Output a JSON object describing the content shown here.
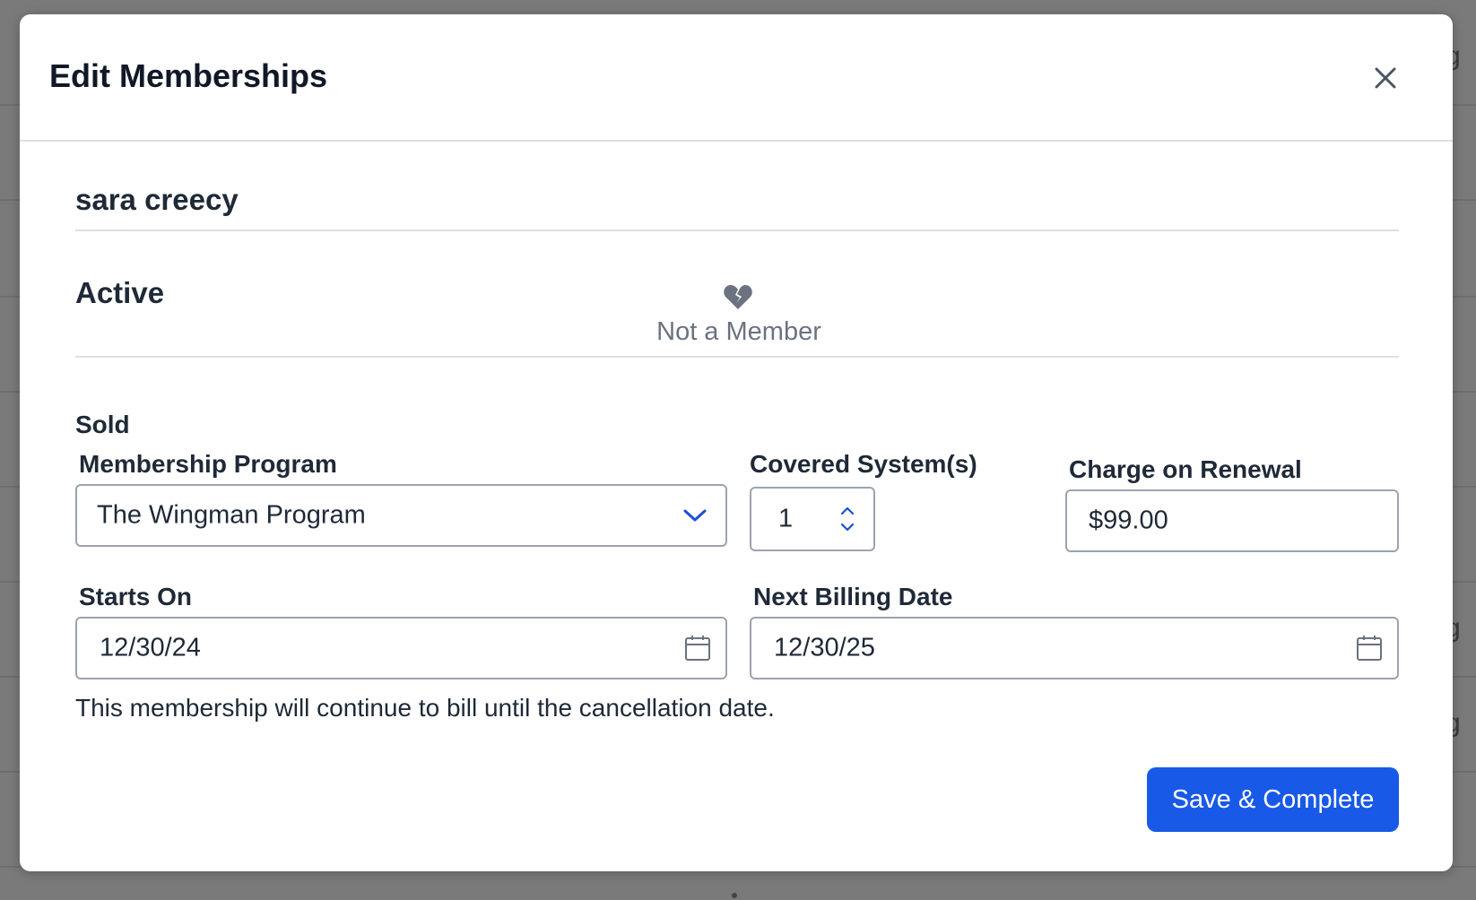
{
  "background": {
    "partial_text": [
      "g",
      "g",
      "g"
    ]
  },
  "modal": {
    "title": "Edit Memberships",
    "close_icon": "close-icon"
  },
  "customer": {
    "name": "sara creecy"
  },
  "status": {
    "label": "Active",
    "icon": "broken-heart-icon",
    "text": "Not a Member"
  },
  "sold": {
    "label": "Sold",
    "membership_program": {
      "label": "Membership Program",
      "value": "The Wingman Program",
      "icon": "chevron-down-icon"
    },
    "covered_systems": {
      "label": "Covered System(s)",
      "value": "1",
      "icon": "stepper-arrows-icon"
    },
    "charge_on_renewal": {
      "label": "Charge on Renewal",
      "value": "$99.00"
    },
    "starts_on": {
      "label": "Starts On",
      "value": "12/30/24",
      "icon": "calendar-icon"
    },
    "next_billing_date": {
      "label": "Next Billing Date",
      "value": "12/30/25",
      "icon": "calendar-icon"
    },
    "help_text": "This membership will continue to bill until the cancellation date."
  },
  "actions": {
    "save_label": "Save & Complete"
  },
  "colors": {
    "primary": "#1859e8",
    "chevron": "#1d4ed8",
    "overlay": "#7a7a7a"
  }
}
